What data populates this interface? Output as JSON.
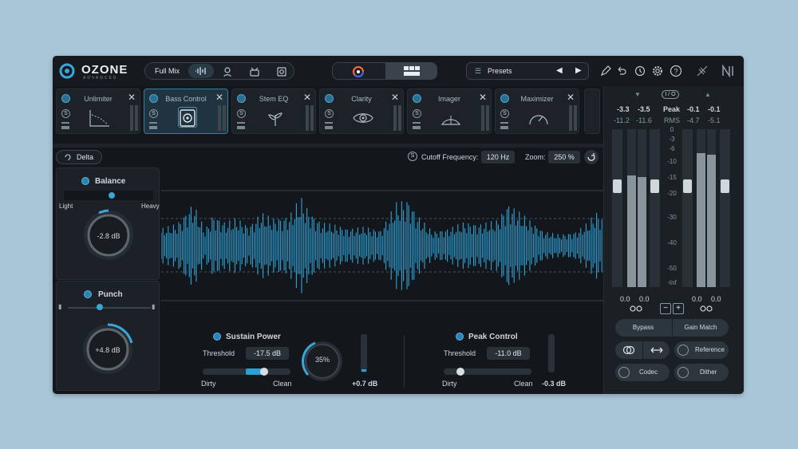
{
  "app": {
    "logo_text": "OZONE",
    "logo_sub": "ADVANCED"
  },
  "toolbar": {
    "mix_label": "Full Mix",
    "presets_label": "Presets",
    "icons": [
      "waveform-icon",
      "vocal-icon",
      "drums-icon",
      "bass-icon",
      "undo-icon",
      "history-icon",
      "gear-icon",
      "help-icon",
      "pen-icon",
      "ni-logo-icon",
      "slash-logo-icon"
    ]
  },
  "modules": [
    {
      "label": "Unlimiter",
      "active": false
    },
    {
      "label": "Bass Control",
      "active": true
    },
    {
      "label": "Stem EQ",
      "active": false
    },
    {
      "label": "Clarity",
      "active": false
    },
    {
      "label": "Imager",
      "active": false
    },
    {
      "label": "Maximizer",
      "active": false
    }
  ],
  "controls": {
    "delta_label": "Delta",
    "cutoff_label": "Cutoff Frequency:",
    "cutoff_value": "120 Hz",
    "zoom_label": "Zoom:",
    "zoom_value": "250 %"
  },
  "balance": {
    "title": "Balance",
    "left": "Light",
    "right": "Heavy",
    "value": "-2.8 dB"
  },
  "punch": {
    "title": "Punch",
    "value": "+4.8 dB"
  },
  "sustain": {
    "title": "Sustain Power",
    "threshold_label": "Threshold",
    "threshold_value": "-17.5 dB",
    "left": "Dirty",
    "right": "Clean",
    "amount": "35%",
    "meter_value": "+0.7 dB"
  },
  "peak": {
    "title": "Peak Control",
    "threshold_label": "Threshold",
    "threshold_value": "-11.0 dB",
    "left": "Dirty",
    "right": "Clean",
    "meter_value": "-0.3 dB"
  },
  "meters": {
    "io_label": "I / O",
    "peak_label": "Peak",
    "rms_label": "RMS",
    "in_peak": [
      "-3.3",
      "-3.5"
    ],
    "in_rms": [
      "-11.2",
      "-11.6"
    ],
    "out_peak": [
      "-0.1",
      "-0.1"
    ],
    "out_rms": [
      "-4.7",
      "-5.1"
    ],
    "scale": [
      "0",
      "-3",
      "-6",
      "-10",
      "-15",
      "-20",
      "-30",
      "-40",
      "-50",
      "-Inf"
    ],
    "in_gain": [
      "0.0",
      "0.0"
    ],
    "out_gain": [
      "0.0",
      "0.0"
    ],
    "minus": "−",
    "plus": "+"
  },
  "bottom_buttons": {
    "bypass": "Bypass",
    "gain_match": "Gain Match",
    "reference": "Reference",
    "codec": "Codec",
    "dither": "Dither"
  },
  "colors": {
    "accent": "#2a9fd6",
    "bg": "#13171c",
    "page": "#a9c6d8"
  }
}
